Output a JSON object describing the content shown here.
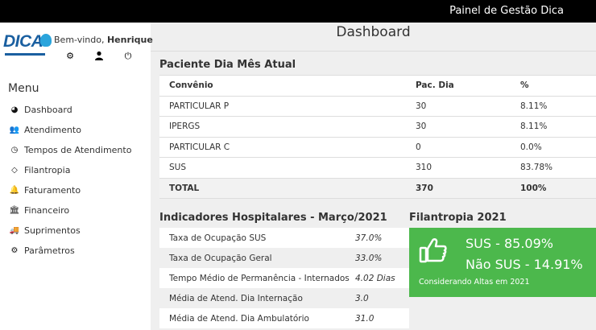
{
  "topbar": {
    "title": "Painel de Gestão Dica"
  },
  "brand": {
    "logo_text": "DICA"
  },
  "header": {
    "welcome": "Bem-vindo, ",
    "user": "Henrique",
    "icons": [
      "gear-icon",
      "user-icon",
      "power-icon"
    ]
  },
  "sidebar": {
    "menu_title": "Menu",
    "items": [
      {
        "label": "Dashboard",
        "icon": "dashboard-icon",
        "glyph": "◕"
      },
      {
        "label": "Atendimento",
        "icon": "users-icon",
        "glyph": "👥"
      },
      {
        "label": "Tempos de Atendimento",
        "icon": "clock-icon",
        "glyph": "◷"
      },
      {
        "label": "Filantropia",
        "icon": "diamond-icon",
        "glyph": "◇"
      },
      {
        "label": "Faturamento",
        "icon": "bell-icon",
        "glyph": "🔔"
      },
      {
        "label": "Financeiro",
        "icon": "bank-icon",
        "glyph": "🏛"
      },
      {
        "label": "Suprimentos",
        "icon": "truck-icon",
        "glyph": "🚚"
      },
      {
        "label": "Parâmetros",
        "icon": "gear-icon",
        "glyph": "⚙"
      }
    ]
  },
  "main": {
    "title": "Dashboard"
  },
  "paciente": {
    "title": "Paciente Dia Mês Atual",
    "headers": [
      "Convênio",
      "Pac. Dia",
      "%"
    ],
    "rows": [
      [
        "PARTICULAR P",
        "30",
        "8.11%"
      ],
      [
        "IPERGS",
        "30",
        "8.11%"
      ],
      [
        "PARTICULAR C",
        "0",
        "0.0%"
      ],
      [
        "SUS",
        "310",
        "83.78%"
      ]
    ],
    "total": [
      "TOTAL",
      "370",
      "100%"
    ]
  },
  "indicadores": {
    "title": "Indicadores Hospitalares - Março/2021",
    "rows": [
      [
        "Taxa de Ocupação SUS",
        "37.0%"
      ],
      [
        "Taxa de Ocupação Geral",
        "33.0%"
      ],
      [
        "Tempo Médio de Permanência - Internados",
        "4.02 Dias"
      ],
      [
        "Média de Atend. Dia Internação",
        "3.0"
      ],
      [
        "Média de Atend. Dia Ambulatório",
        "31.0"
      ]
    ]
  },
  "filantropia": {
    "title": "Filantropia 2021",
    "sus": "SUS - 85.09%",
    "nao_sus": "Não SUS - 14.91%",
    "note": "Considerando Altas em 2021",
    "color": "#4cb84c"
  }
}
